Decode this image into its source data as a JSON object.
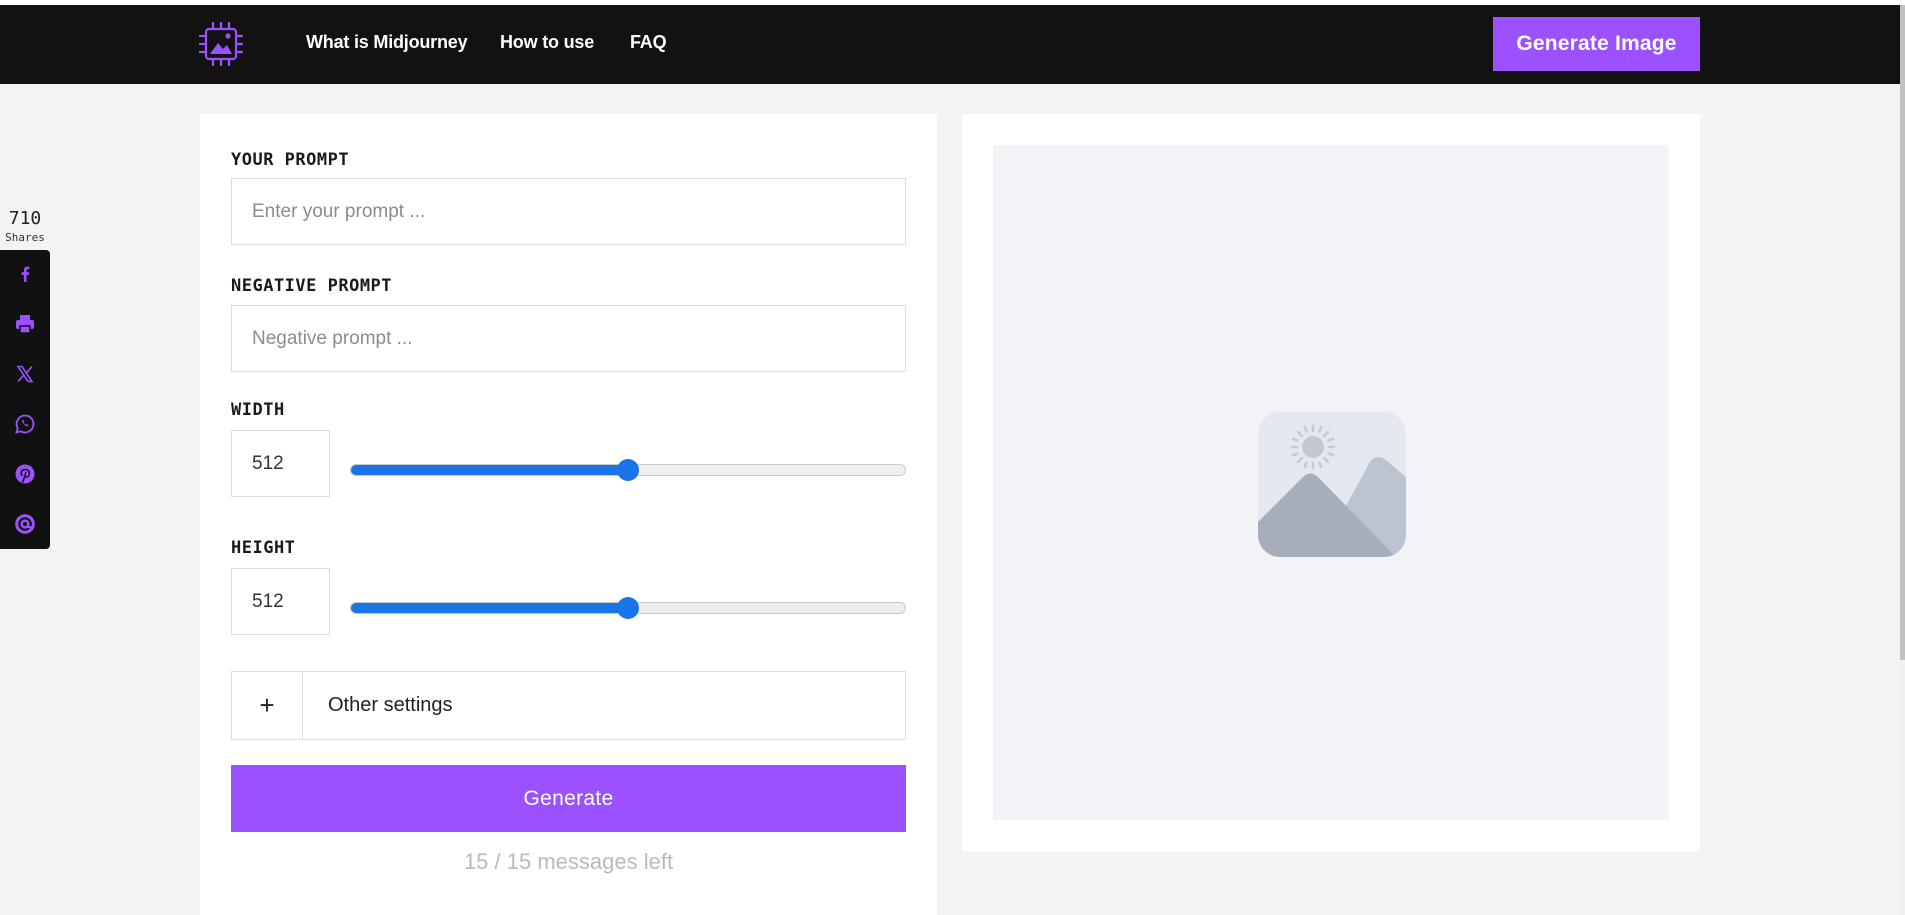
{
  "nav": {
    "links": [
      "What is Midjourney",
      "How to use",
      "FAQ"
    ],
    "cta_label": "Generate Image"
  },
  "share": {
    "count": "710",
    "label": "Shares",
    "icons": [
      "facebook-icon",
      "print-icon",
      "x-icon",
      "whatsapp-icon",
      "pinterest-icon",
      "email-icon"
    ]
  },
  "form": {
    "prompt_label": "YOUR PROMPT",
    "prompt_placeholder": "Enter your prompt ...",
    "negative_label": "NEGATIVE PROMPT",
    "negative_placeholder": "Negative prompt ...",
    "width_label": "WIDTH",
    "width_value": "512",
    "width_slider_fraction": 0.5,
    "height_label": "HEIGHT",
    "height_value": "512",
    "height_slider_fraction": 0.5,
    "other_settings_symbol": "+",
    "other_settings_label": "Other settings",
    "generate_label": "Generate",
    "messages_left": "15 / 15 messages left"
  },
  "colors": {
    "accent": "#9b51ff",
    "navbar": "#121212",
    "slider": "#1a73e8"
  }
}
